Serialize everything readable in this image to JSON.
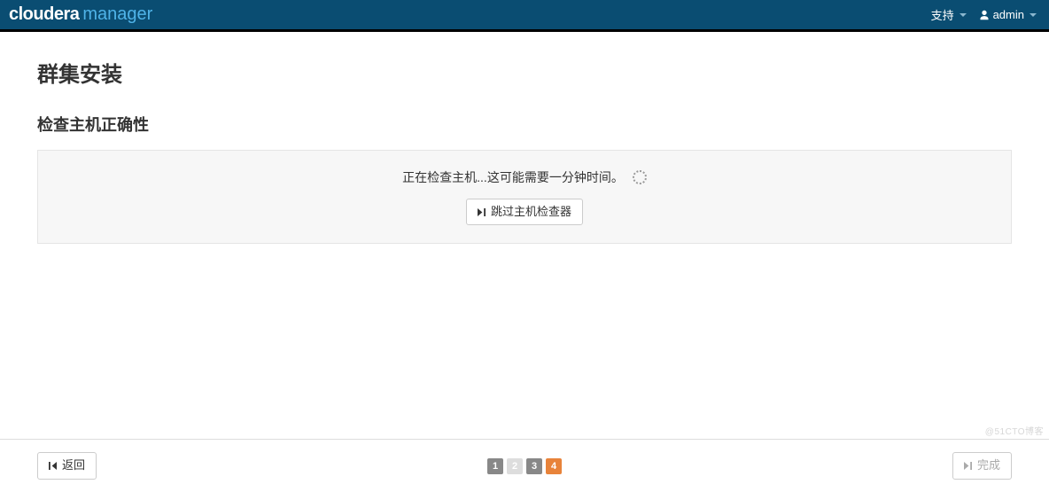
{
  "brand": {
    "left": "cloudera",
    "right": "manager"
  },
  "nav": {
    "support": "支持",
    "user": "admin"
  },
  "page": {
    "title": "群集安装",
    "sectionTitle": "检查主机正确性",
    "statusText": "正在检查主机...这可能需要一分钟时间。",
    "skipButton": "跳过主机检查器"
  },
  "footer": {
    "backLabel": "返回",
    "finishLabel": "完成",
    "steps": [
      "1",
      "2",
      "3",
      "4"
    ],
    "currentStep": 4
  },
  "watermark": "@51CTO博客"
}
